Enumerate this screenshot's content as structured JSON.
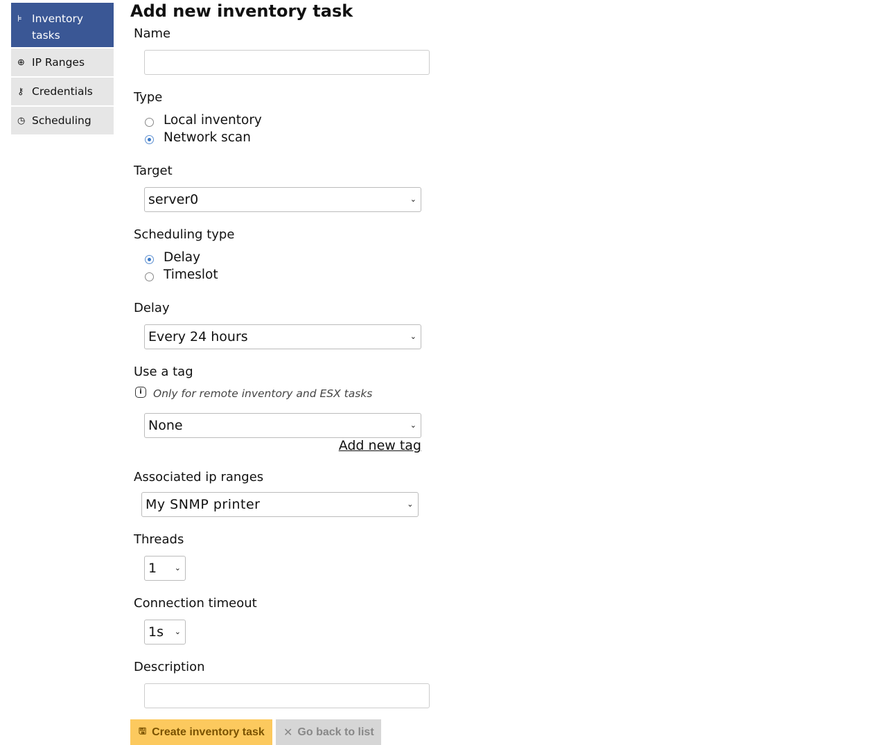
{
  "sidebar": {
    "items": [
      {
        "label": "Inventory tasks",
        "icon": "tree-icon",
        "active": true
      },
      {
        "label": "IP Ranges",
        "icon": "network-icon"
      },
      {
        "label": "Credentials",
        "icon": "key-icon"
      },
      {
        "label": "Scheduling",
        "icon": "clock-icon"
      }
    ]
  },
  "title": "Add new inventory task",
  "form": {
    "name_label": "Name",
    "name_value": "",
    "type_label": "Type",
    "type_options": [
      "Local inventory",
      "Network scan"
    ],
    "type_selected": "Network scan",
    "target_label": "Target",
    "target_value": "server0",
    "sched_label": "Scheduling type",
    "sched_options": [
      "Delay",
      "Timeslot"
    ],
    "sched_selected": "Delay",
    "delay_label": "Delay",
    "delay_value": "Every 24 hours",
    "tag_label": "Use a tag",
    "tag_hint": "Only for remote inventory and ESX tasks",
    "tag_value": "None",
    "add_tag": "Add new tag",
    "ip_label": "Associated ip ranges",
    "ip_value": "My SNMP printer",
    "threads_label": "Threads",
    "threads_value": "1",
    "timeout_label": "Connection timeout",
    "timeout_value": "1s",
    "desc_label": "Description",
    "desc_value": ""
  },
  "buttons": {
    "create": "Create inventory task",
    "back": "Go back to list"
  },
  "colors": {
    "sidebar_active": "#3a5795",
    "create_btn": "#fcc95e",
    "back_btn": "#d6d6d6"
  }
}
